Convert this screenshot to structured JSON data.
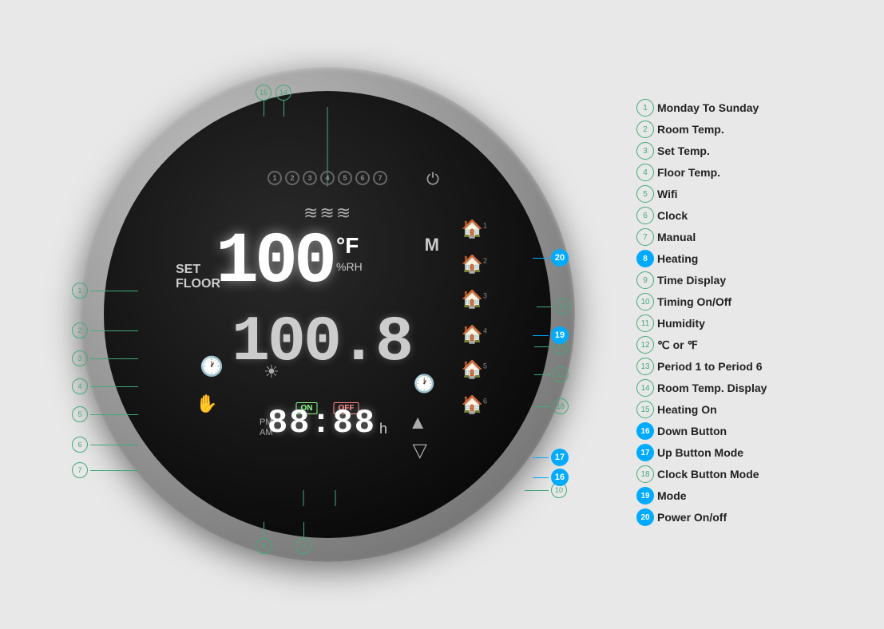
{
  "thermostat": {
    "main_temp": "100",
    "unit": "°F",
    "rh": "%RH",
    "second_line": "100.8",
    "set_label": "SET",
    "floor_label": "FLOOR",
    "time_value": "88:88",
    "time_unit": "h",
    "on_label": "ON",
    "off_label": "OFF",
    "pm_label": "PM",
    "am_label": "AM",
    "manual_label": "M"
  },
  "legend": [
    {
      "num": "1",
      "text": "Monday To Sunday",
      "cyan": false
    },
    {
      "num": "2",
      "text": "Room Temp.",
      "cyan": false
    },
    {
      "num": "3",
      "text": "Set Temp.",
      "cyan": false
    },
    {
      "num": "4",
      "text": "Floor Temp.",
      "cyan": false
    },
    {
      "num": "5",
      "text": "Wifi",
      "cyan": false
    },
    {
      "num": "6",
      "text": "Clock",
      "cyan": false
    },
    {
      "num": "7",
      "text": "Manual",
      "cyan": false
    },
    {
      "num": "8",
      "text": "Heating",
      "cyan": true
    },
    {
      "num": "9",
      "text": "Time Display",
      "cyan": false
    },
    {
      "num": "10",
      "text": "Timing On/Off",
      "cyan": false
    },
    {
      "num": "11",
      "text": "Humidity",
      "cyan": false
    },
    {
      "num": "12",
      "text": "℃ or ℉",
      "cyan": false
    },
    {
      "num": "13",
      "text": "Period 1 to Period 6",
      "cyan": false
    },
    {
      "num": "14",
      "text": "Room Temp. Display",
      "cyan": false
    },
    {
      "num": "15",
      "text": "Heating On",
      "cyan": false
    },
    {
      "num": "16",
      "text": "Down Button",
      "cyan": true
    },
    {
      "num": "17",
      "text": "Up Button Mode",
      "cyan": true
    },
    {
      "num": "18",
      "text": "Clock Button Mode",
      "cyan": false
    },
    {
      "num": "19",
      "text": "Mode",
      "cyan": true
    },
    {
      "num": "20",
      "text": "Power On/off",
      "cyan": true
    }
  ],
  "annotations": {
    "left": [
      {
        "id": "1",
        "top": "310",
        "label": "①"
      },
      {
        "id": "2",
        "top": "350",
        "label": "②"
      },
      {
        "id": "3",
        "top": "380",
        "label": "③"
      },
      {
        "id": "4",
        "top": "410",
        "label": "④"
      },
      {
        "id": "5",
        "top": "440",
        "label": "⑤"
      },
      {
        "id": "6",
        "top": "490",
        "label": "⑥"
      },
      {
        "id": "7",
        "top": "520",
        "label": "⑦"
      }
    ]
  }
}
